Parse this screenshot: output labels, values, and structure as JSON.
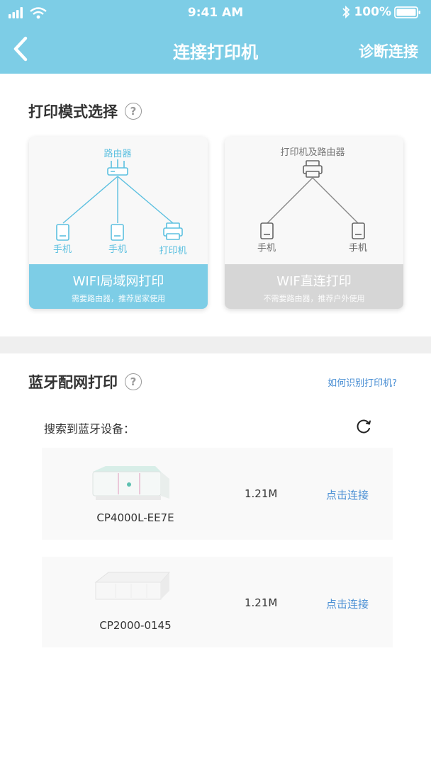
{
  "status_bar": {
    "time": "9:41 AM",
    "battery": "100%"
  },
  "header": {
    "title": "连接打印机",
    "action": "诊断连接"
  },
  "print_mode": {
    "title": "打印模式选择",
    "help": "?",
    "cards": [
      {
        "top_label": "路由器",
        "bottom_labels": [
          "手机",
          "手机",
          "打印机"
        ],
        "title": "WIFI局域网打印",
        "subtitle": "需要路由器，推荐居家使用",
        "active": true
      },
      {
        "top_label": "打印机及路由器",
        "bottom_labels": [
          "手机",
          "手机"
        ],
        "title": "WIF直连打印",
        "subtitle": "不需要路由器，推荐户外使用",
        "active": false
      }
    ]
  },
  "bluetooth": {
    "title": "蓝牙配网打印",
    "help": "?",
    "how_link": "如何识别打印机?",
    "search_label": "搜索到蓝牙设备：",
    "devices": [
      {
        "name": "CP4000L-EE7E",
        "size": "1.21M",
        "action": "点击连接"
      },
      {
        "name": "CP2000-0145",
        "size": "1.21M",
        "action": "点击连接"
      }
    ]
  },
  "colors": {
    "accent": "#7dcde6",
    "link": "#4a8fd4",
    "inactive": "#d6d6d6"
  }
}
